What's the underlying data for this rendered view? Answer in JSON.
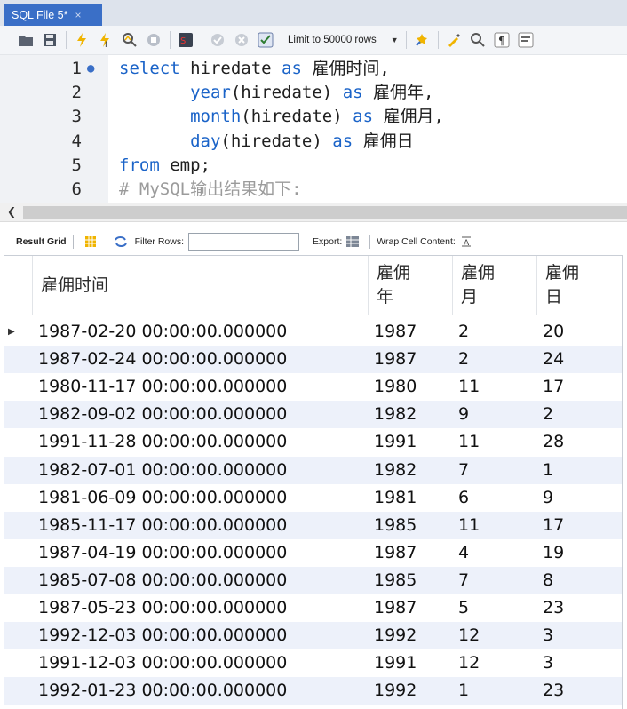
{
  "tab": {
    "title": "SQL File 5*",
    "close": "×"
  },
  "toolbar": {
    "limit_label": "Limit to 50000 rows",
    "icons": [
      "open-folder-icon",
      "save-icon",
      "execute-icon",
      "execute-current-icon",
      "explain-icon",
      "stop-icon",
      "toggle-output-icon",
      "commit-icon",
      "rollback-icon",
      "autocommit-icon",
      "beautify-icon",
      "find-icon",
      "invisible-chars-icon",
      "wrap-icon"
    ]
  },
  "editor": {
    "lines": [
      {
        "num": "1",
        "parts": [
          [
            "kw",
            "select"
          ],
          [
            "t",
            " hiredate "
          ],
          [
            "kw",
            "as"
          ],
          [
            "t",
            " "
          ],
          [
            "cjk",
            "雇佣时间"
          ],
          [
            "t",
            ","
          ]
        ]
      },
      {
        "num": "2",
        "parts": [
          [
            "t",
            "       "
          ],
          [
            "kw",
            "year"
          ],
          [
            "t",
            "(hiredate) "
          ],
          [
            "kw",
            "as"
          ],
          [
            "t",
            " "
          ],
          [
            "cjk",
            "雇佣年"
          ],
          [
            "t",
            ","
          ]
        ]
      },
      {
        "num": "3",
        "parts": [
          [
            "t",
            "       "
          ],
          [
            "kw",
            "month"
          ],
          [
            "t",
            "(hiredate) "
          ],
          [
            "kw",
            "as"
          ],
          [
            "t",
            " "
          ],
          [
            "cjk",
            "雇佣月"
          ],
          [
            "t",
            ","
          ]
        ]
      },
      {
        "num": "4",
        "parts": [
          [
            "t",
            "       "
          ],
          [
            "kw",
            "day"
          ],
          [
            "t",
            "(hiredate) "
          ],
          [
            "kw",
            "as"
          ],
          [
            "t",
            " "
          ],
          [
            "cjk",
            "雇佣日"
          ]
        ]
      },
      {
        "num": "5",
        "parts": [
          [
            "kw",
            "from"
          ],
          [
            "t",
            " emp;"
          ]
        ]
      },
      {
        "num": "6",
        "parts": [
          [
            "cm",
            "# MySQL输出结果如下:"
          ]
        ]
      }
    ]
  },
  "result_toolbar": {
    "result_grid": "Result Grid",
    "filter_rows": "Filter Rows:",
    "export": "Export:",
    "wrap": "Wrap Cell Content:"
  },
  "grid": {
    "columns": [
      {
        "name": "col-hire-time",
        "lines": [
          "雇佣时间"
        ]
      },
      {
        "name": "col-hire-year",
        "lines": [
          "雇佣",
          "年"
        ]
      },
      {
        "name": "col-hire-month",
        "lines": [
          "雇佣",
          "月"
        ]
      },
      {
        "name": "col-hire-day",
        "lines": [
          "雇佣",
          "日"
        ]
      }
    ],
    "rows": [
      [
        "1987-02-20 00:00:00.000000",
        "1987",
        "2",
        "20"
      ],
      [
        "1987-02-24 00:00:00.000000",
        "1987",
        "2",
        "24"
      ],
      [
        "1980-11-17 00:00:00.000000",
        "1980",
        "11",
        "17"
      ],
      [
        "1982-09-02 00:00:00.000000",
        "1982",
        "9",
        "2"
      ],
      [
        "1991-11-28 00:00:00.000000",
        "1991",
        "11",
        "28"
      ],
      [
        "1982-07-01 00:00:00.000000",
        "1982",
        "7",
        "1"
      ],
      [
        "1981-06-09 00:00:00.000000",
        "1981",
        "6",
        "9"
      ],
      [
        "1985-11-17 00:00:00.000000",
        "1985",
        "11",
        "17"
      ],
      [
        "1987-04-19 00:00:00.000000",
        "1987",
        "4",
        "19"
      ],
      [
        "1985-07-08 00:00:00.000000",
        "1985",
        "7",
        "8"
      ],
      [
        "1987-05-23 00:00:00.000000",
        "1987",
        "5",
        "23"
      ],
      [
        "1992-12-03 00:00:00.000000",
        "1992",
        "12",
        "3"
      ],
      [
        "1991-12-03 00:00:00.000000",
        "1991",
        "12",
        "3"
      ],
      [
        "1992-01-23 00:00:00.000000",
        "1992",
        "1",
        "23"
      ]
    ]
  },
  "colors": {
    "accent": "#3a6fc7",
    "keyword": "#1a63c8",
    "comment": "#9b9b9b",
    "alt_row": "#edf1fa"
  }
}
